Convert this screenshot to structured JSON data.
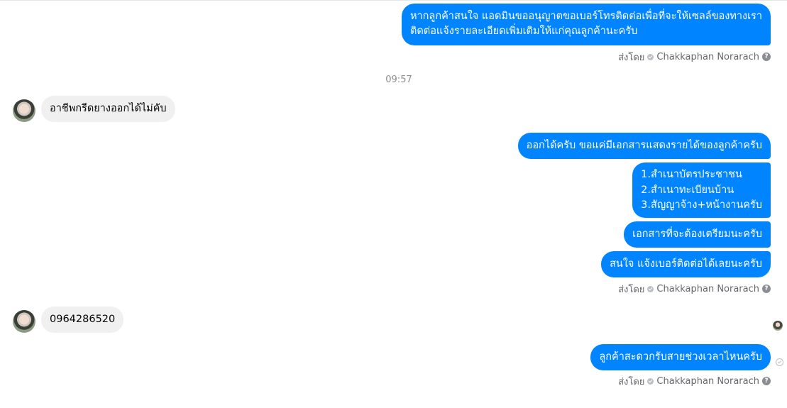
{
  "thread": {
    "timestamp": "09:57",
    "sender_prefix": "ส่งโดย",
    "sender_name": "Chakkaphan Norarach",
    "messages": {
      "m1": {
        "lines": [
          "หากลูกค้าสนใจ แอดมินขออนุญาตขอเบอร์โทรติดต่อเพื่อที่จะให้เซลล์ของทางเรา",
          "ติดต่อแจ้งรายละเอียดเพิ่มเติมให้แก่คุณลูกค้านะครับ"
        ]
      },
      "m2": {
        "text": "อาชีพกรีดยางออกได้ไม่คับ"
      },
      "m3": {
        "text": "ออกได้ครับ ขอแค่มีเอกสารแสดงรายได้ของลูกค้าครับ"
      },
      "m4": {
        "lines": [
          "1.สำเนาบัตรประชาชน",
          "2.สำเนาทะเบียนบ้าน",
          "3.สัญญาจ้าง+หน้างานครับ"
        ]
      },
      "m5": {
        "text": "เอกสารที่จะต้องเตรียมนะครับ"
      },
      "m6": {
        "text": "สนใจ แจ้งเบอร์ติดต่อได้เลยนะครับ"
      },
      "m7": {
        "text": "0964286520"
      },
      "m8": {
        "text": "ลูกค้าสะดวกรับสายช่วงเวลาไหนครับ"
      }
    }
  },
  "colors": {
    "outgoing_bubble": "#0084ff",
    "incoming_bubble": "#f0f0f0",
    "meta_text": "#65676b"
  },
  "icons": [
    "verified-check-icon",
    "help-icon",
    "avatar",
    "seen-avatar",
    "sent-check-icon"
  ]
}
